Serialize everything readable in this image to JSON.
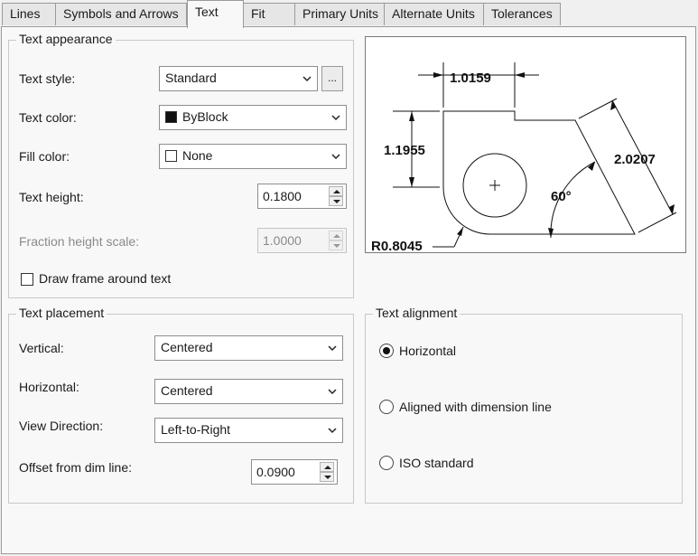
{
  "tabs": [
    {
      "label": "Lines"
    },
    {
      "label": "Symbols and Arrows"
    },
    {
      "label": "Text"
    },
    {
      "label": "Fit"
    },
    {
      "label": "Primary Units"
    },
    {
      "label": "Alternate Units"
    },
    {
      "label": "Tolerances"
    }
  ],
  "active_tab": "Text",
  "text_appearance": {
    "title": "Text appearance",
    "text_style": {
      "label": "Text style:",
      "value": "Standard",
      "browse_label": "..."
    },
    "text_color": {
      "label": "Text color:",
      "value": "ByBlock",
      "swatch": "#111111"
    },
    "fill_color": {
      "label": "Fill color:",
      "value": "None",
      "swatch": "#ffffff"
    },
    "text_height": {
      "label": "Text height:",
      "value": "0.1800"
    },
    "fraction_height_scale": {
      "label": "Fraction height scale:",
      "value": "1.0000",
      "enabled": false
    },
    "draw_frame": {
      "label": "Draw frame around text",
      "checked": false
    }
  },
  "text_placement": {
    "title": "Text placement",
    "vertical": {
      "label": "Vertical:",
      "value": "Centered"
    },
    "horizontal": {
      "label": "Horizontal:",
      "value": "Centered"
    },
    "view_direction": {
      "label": "View Direction:",
      "value": "Left-to-Right"
    },
    "offset": {
      "label": "Offset from dim line:",
      "value": "0.0900"
    }
  },
  "text_alignment": {
    "title": "Text alignment",
    "options": [
      {
        "label": "Horizontal",
        "selected": true
      },
      {
        "label": "Aligned with dimension line",
        "selected": false
      },
      {
        "label": "ISO standard",
        "selected": false
      }
    ]
  },
  "preview": {
    "dim_top": "1.0159",
    "dim_left": "1.1955",
    "dim_right": "2.0207",
    "angle": "60°",
    "radius": "R0.8045"
  }
}
